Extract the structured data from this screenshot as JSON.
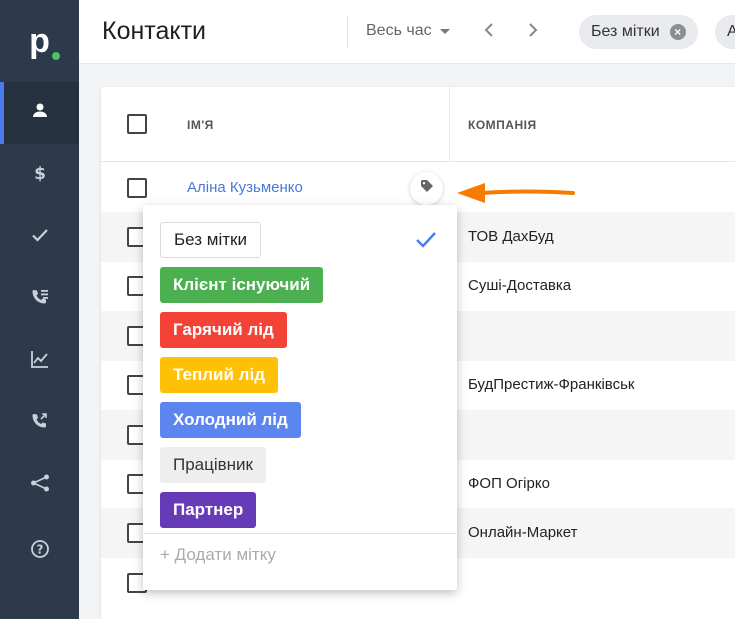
{
  "header": {
    "title": "Контакти",
    "period": "Весь час",
    "chips": [
      "Без мітки",
      "А"
    ]
  },
  "sidebar": {
    "logo": "p",
    "items": [
      {
        "icon": "person-icon",
        "active": true
      },
      {
        "icon": "dollar-icon",
        "active": false
      },
      {
        "icon": "check-icon",
        "active": false
      },
      {
        "icon": "call-list-icon",
        "active": false
      },
      {
        "icon": "chart-icon",
        "active": false
      },
      {
        "icon": "phone-transfer-icon",
        "active": false
      },
      {
        "icon": "share-icon",
        "active": false
      },
      {
        "icon": "help-icon",
        "active": false
      }
    ]
  },
  "table": {
    "columns": [
      "ІМ'Я",
      "КОМПАНІЯ"
    ],
    "rows": [
      {
        "name": "Аліна Кузьменко",
        "company": ""
      },
      {
        "name": "",
        "company": "ТОВ ДахБуд"
      },
      {
        "name": "",
        "company": "Суші-Доставка"
      },
      {
        "name": "",
        "company": ""
      },
      {
        "name": "",
        "company": "БудПрестиж-Франківськ"
      },
      {
        "name": "",
        "company": ""
      },
      {
        "name": "",
        "company": "ФОП Огірко"
      },
      {
        "name": "",
        "company": "Онлайн-Маркет"
      },
      {
        "name": "",
        "company": ""
      }
    ]
  },
  "label_menu": {
    "options": [
      {
        "label": "Без мітки",
        "bg": "#ffffff",
        "color": "#222222",
        "border": "#dddddd",
        "selected": true
      },
      {
        "label": "Клієнт існуючий",
        "bg": "#4caf50",
        "color": "#ffffff",
        "selected": false
      },
      {
        "label": "Гарячий лід",
        "bg": "#f44336",
        "color": "#ffffff",
        "selected": false
      },
      {
        "label": "Теплий лід",
        "bg": "#ffc107",
        "color": "#ffffff",
        "selected": false
      },
      {
        "label": "Холодний лід",
        "bg": "#5c85f0",
        "color": "#ffffff",
        "selected": false
      },
      {
        "label": "Працівник",
        "bg": "#eeeeee",
        "color": "#333333",
        "selected": false
      },
      {
        "label": "Партнер",
        "bg": "#673ab7",
        "color": "#ffffff",
        "selected": false
      }
    ],
    "add_label": "+ Додати мітку"
  },
  "colors": {
    "sidebar": "#2c3a4b",
    "accent": "#4a7cf0",
    "arrow": "#f57c00",
    "link": "#4a78d8"
  }
}
